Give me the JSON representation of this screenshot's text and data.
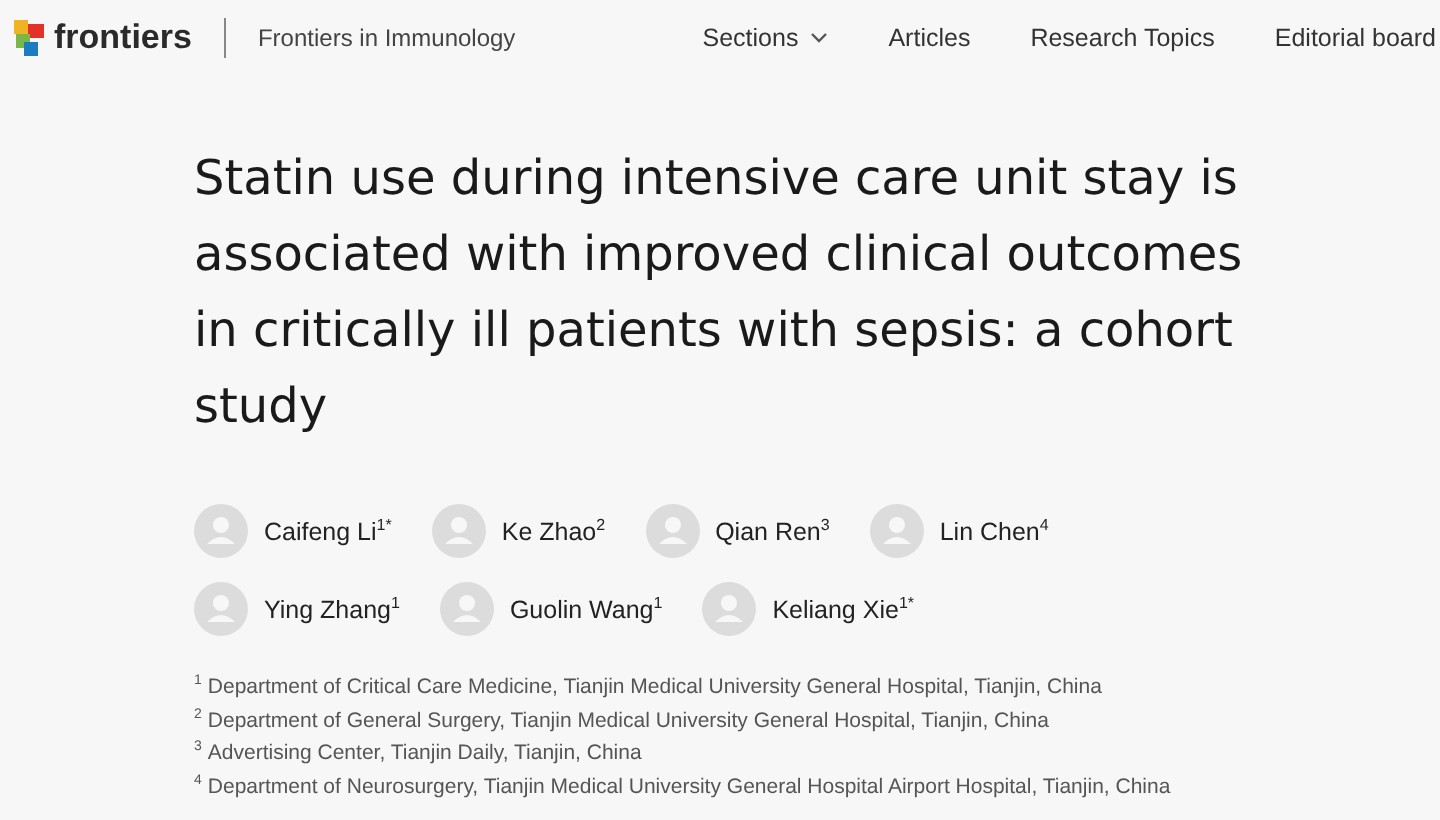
{
  "header": {
    "brand": "frontiers",
    "journal": "Frontiers in Immunology",
    "nav": [
      {
        "label": "Sections",
        "has_menu": true
      },
      {
        "label": "Articles",
        "has_menu": false
      },
      {
        "label": "Research Topics",
        "has_menu": false
      },
      {
        "label": "Editorial board",
        "has_menu": false
      }
    ]
  },
  "article": {
    "title": "Statin use during intensive care unit stay is associated with improved clinical outcomes in critically ill patients with sepsis: a cohort study",
    "author_rows": [
      [
        {
          "name": "Caifeng Li$^{1*}$"
        },
        {
          "name": "Ke Zhao$^{2}$"
        },
        {
          "name": "Qian Ren$^{3}$"
        },
        {
          "name": "Lin Chen$^{4}$"
        }
      ],
      [
        {
          "name": "Ying Zhang$^{1}$"
        },
        {
          "name": "Guolin Wang$^{1}$"
        },
        {
          "name": "Keliang Xie$^{1*}$"
        }
      ]
    ],
    "affiliations": [
      {
        "mark": "1",
        "text": "Department of Critical Care Medicine, Tianjin Medical University General Hospital, Tianjin, China"
      },
      {
        "mark": "2",
        "text": "Department of General Surgery, Tianjin Medical University General Hospital, Tianjin, China"
      },
      {
        "mark": "3",
        "text": "Advertising Center, Tianjin Daily, Tianjin, China"
      },
      {
        "mark": "4",
        "text": "Department of Neurosurgery, Tianjin Medical University General Hospital Airport Hospital, Tianjin, China"
      }
    ]
  }
}
